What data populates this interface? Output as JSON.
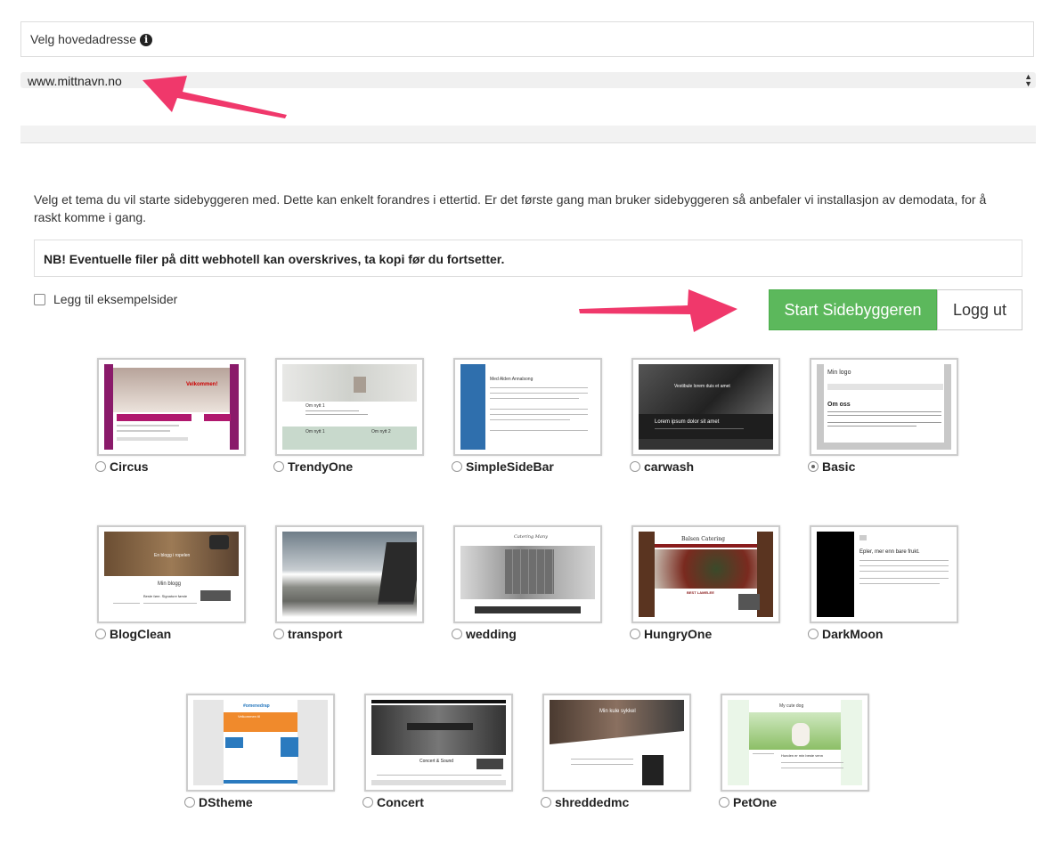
{
  "header": {
    "label": "Velg hovedadresse",
    "info_icon": "info-icon"
  },
  "domain_select": {
    "value": "www.mittnavn.no"
  },
  "intro_text": "Velg et tema du vil starte sidebyggeren med. Dette kan enkelt forandres i ettertid. Er det første gang man bruker sidebyggeren så anbefaler vi installasjon av demodata, for å raskt komme i gang.",
  "warning_text": "NB! Eventuelle filer på ditt webhotell kan overskrives, ta kopi før du fortsetter.",
  "checkbox": {
    "label": "Legg til eksempelsider",
    "checked": false
  },
  "buttons": {
    "start": "Start Sidebyggeren",
    "logout": "Logg ut"
  },
  "colors": {
    "start_button": "#5cb85c",
    "annotation_arrow": "#f0386b"
  },
  "selected_theme": "Basic",
  "themes": [
    {
      "name": "Circus"
    },
    {
      "name": "TrendyOne"
    },
    {
      "name": "SimpleSideBar"
    },
    {
      "name": "carwash"
    },
    {
      "name": "Basic"
    },
    {
      "name": "BlogClean"
    },
    {
      "name": "transport"
    },
    {
      "name": "wedding"
    },
    {
      "name": "HungryOne"
    },
    {
      "name": "DarkMoon"
    },
    {
      "name": "DStheme"
    },
    {
      "name": "Concert"
    },
    {
      "name": "shreddedmc"
    },
    {
      "name": "PetOne"
    }
  ],
  "preview_text": {
    "circus": "Velkommen!",
    "trendy_1": "Om nytt 1",
    "trendy_2": "Om nytt 1",
    "trendy_3": "Om nytt 2",
    "simplesidebar": "Med Alden Annalsong",
    "carwash_1": "Vestibule lorem duis et amet",
    "carwash_2": "Lorem ipsum dolor sit amet",
    "basic_logo": "Min logo",
    "basic_heading": "Om oss",
    "blogclean_1": "En blogg i ropelen",
    "blogclean_2": "Min blogg",
    "blogclean_3": "Beste føre. Signature første",
    "wedding": "Catering   Many",
    "hungryone_1": "Balsen Catering",
    "hungryone_2": "BEST LAMELEE",
    "darkmoon_1": "Epler, mer enn bare frukt.",
    "dstheme_1": "#omenedrap",
    "dstheme_2": "Velkommen til",
    "concert_1": "Concert & Sound",
    "shredded": "Min kule sykkel",
    "petone_1": "My cute dog",
    "petone_2": "Hunden er min beste venn"
  }
}
